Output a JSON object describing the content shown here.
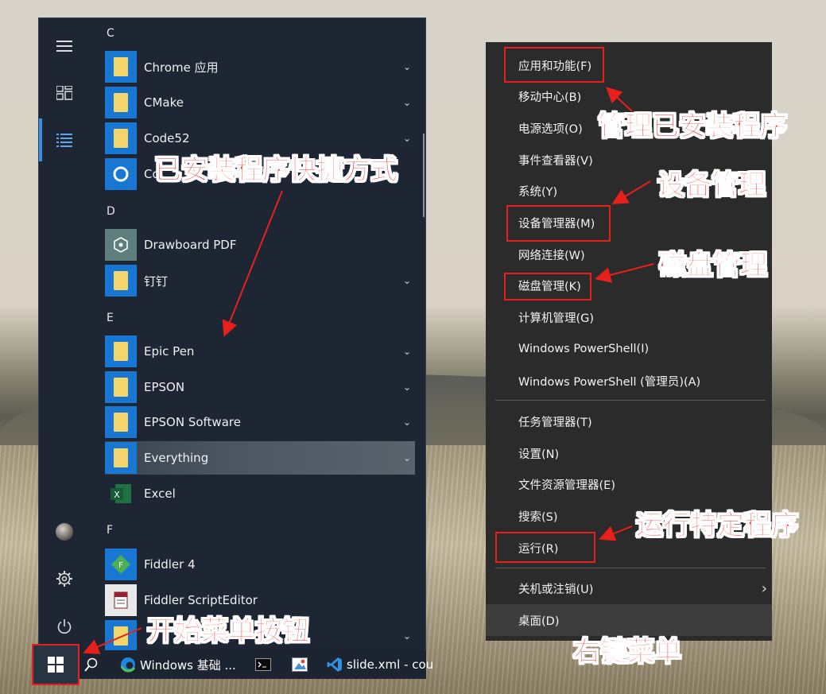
{
  "start_menu": {
    "groups": [
      {
        "letter": "C",
        "apps": [
          {
            "label": "Chrome 应用",
            "icon": "folder-icon",
            "chevron": true
          },
          {
            "label": "CMake",
            "icon": "folder-icon",
            "chevron": true
          },
          {
            "label": "Code52",
            "icon": "folder-icon",
            "chevron": true
          },
          {
            "label": "Co",
            "icon": "cortana-icon",
            "chevron": false
          }
        ]
      },
      {
        "letter": "D",
        "apps": [
          {
            "label": "Drawboard PDF",
            "icon": "drawboard-icon",
            "chevron": false
          },
          {
            "label": "钉钉",
            "icon": "folder-icon",
            "chevron": true
          }
        ]
      },
      {
        "letter": "E",
        "apps": [
          {
            "label": "Epic Pen",
            "icon": "folder-icon",
            "chevron": true
          },
          {
            "label": "EPSON",
            "icon": "folder-icon",
            "chevron": true
          },
          {
            "label": "EPSON Software",
            "icon": "folder-icon",
            "chevron": true
          },
          {
            "label": "Everything",
            "icon": "folder-icon",
            "chevron": true
          },
          {
            "label": "Excel",
            "icon": "excel-icon",
            "chevron": false
          }
        ]
      },
      {
        "letter": "F",
        "apps": [
          {
            "label": "Fiddler 4",
            "icon": "fiddler-icon",
            "chevron": false
          },
          {
            "label": "Fiddler ScriptEditor",
            "icon": "fiddler-script-icon",
            "chevron": false
          },
          {
            "label": "",
            "icon": "folder-icon",
            "chevron": true
          }
        ]
      }
    ]
  },
  "taskbar": {
    "items": [
      {
        "label": "",
        "icon": "search-icon"
      },
      {
        "label": "Windows 基础 ...",
        "icon": "edge-icon"
      },
      {
        "label": "",
        "icon": "terminal-icon"
      },
      {
        "label": "",
        "icon": "paint-icon"
      },
      {
        "label": "slide.xml - cou",
        "icon": "vscode-icon"
      }
    ]
  },
  "context_menu": {
    "items": [
      "应用和功能(F)",
      "移动中心(B)",
      "电源选项(O)",
      "事件查看器(V)",
      "系统(Y)",
      "设备管理器(M)",
      "网络连接(W)",
      "磁盘管理(K)",
      "计算机管理(G)",
      "Windows PowerShell(I)",
      "Windows PowerShell (管理员)(A)",
      "任务管理器(T)",
      "设置(N)",
      "文件资源管理器(E)",
      "搜索(S)",
      "运行(R)",
      "关机或注销(U)",
      "桌面(D)"
    ]
  },
  "annotations": {
    "installed_shortcuts": "已安装程序快捷方式",
    "start_button": "开始菜单按钮",
    "manage_installed": "管理已安装程序",
    "device_mgmt": "设备管理",
    "disk_mgmt": "磁盘管理",
    "run_program": "运行特定程序",
    "right_click_menu": "右键菜单",
    "color": "#ff1f1f"
  }
}
